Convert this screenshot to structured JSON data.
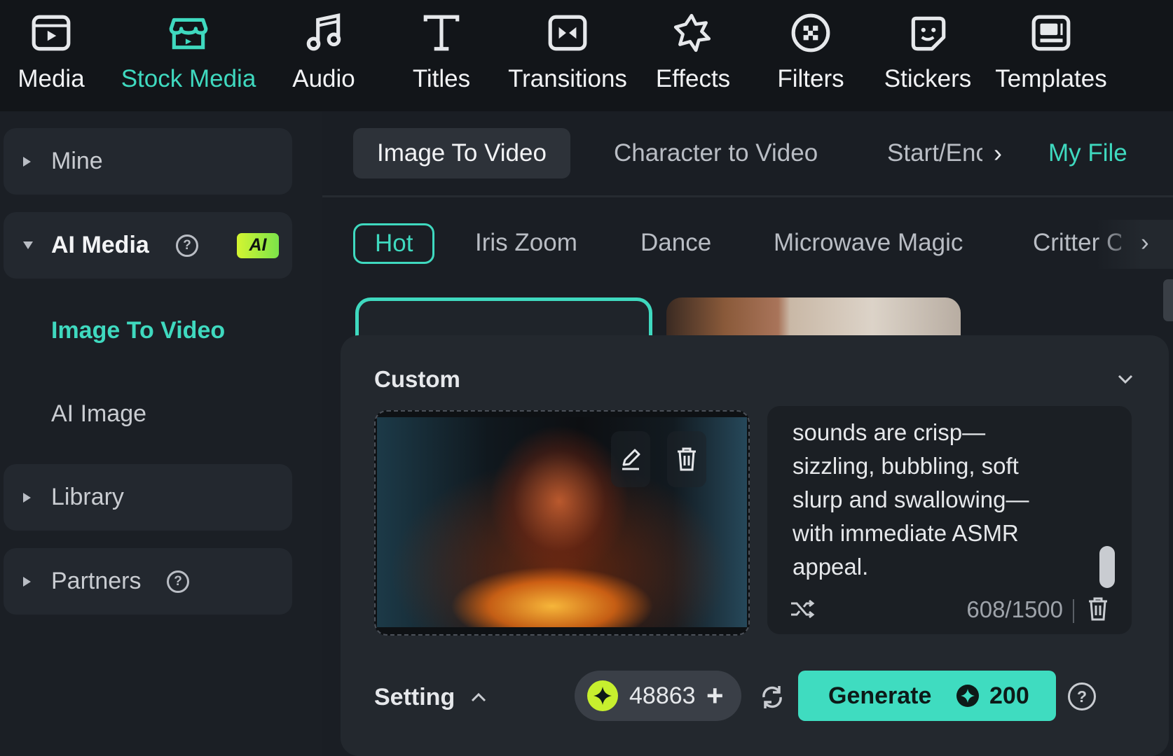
{
  "toolbar": {
    "items": [
      {
        "label": "Media",
        "icon": "media-icon"
      },
      {
        "label": "Stock Media",
        "icon": "stock-media-icon",
        "active": true
      },
      {
        "label": "Audio",
        "icon": "music-note-icon"
      },
      {
        "label": "Titles",
        "icon": "text-t-icon"
      },
      {
        "label": "Transitions",
        "icon": "transitions-icon"
      },
      {
        "label": "Effects",
        "icon": "effects-icon"
      },
      {
        "label": "Filters",
        "icon": "filters-icon"
      },
      {
        "label": "Stickers",
        "icon": "sticker-icon"
      },
      {
        "label": "Templates",
        "icon": "templates-icon"
      }
    ]
  },
  "sidebar": {
    "mine": "Mine",
    "ai_media": "AI Media",
    "ai_badge": "AI",
    "help_glyph": "?",
    "sub_items": [
      "Image To Video",
      "AI Image"
    ],
    "library": "Library",
    "partners": "Partners"
  },
  "tabs": {
    "items": [
      "Image To Video",
      "Character to Video",
      "Start/Enc",
      "My File"
    ],
    "more_glyph": "›"
  },
  "chips": {
    "items": [
      "Hot",
      "Iris Zoom",
      "Dance",
      "Microwave Magic",
      "Critter C"
    ],
    "more_glyph": "›"
  },
  "custom": {
    "title": "Custom",
    "prompt": "sounds are crisp—\nsizzling, bubbling, soft\nslurp and swallowing—\nwith immediate ASMR\nappeal.",
    "counter": "608/1500"
  },
  "footer": {
    "setting": "Setting",
    "credits": "48863",
    "plus": "+",
    "generate": "Generate",
    "cost": "200",
    "help": "?"
  },
  "colors": {
    "accent": "#3fd9bf",
    "ai_badge": "#c7ef2e",
    "toolbar_bg": "#121519",
    "panel_bg": "#23282e"
  }
}
